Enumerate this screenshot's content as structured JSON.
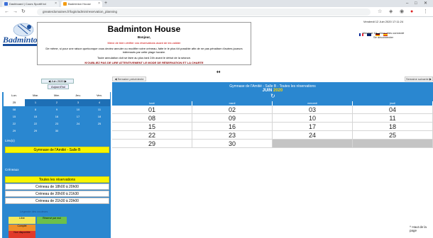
{
  "browser": {
    "tab1_title": "Dashboard | Cours Sportif bd",
    "tab2_title": "Badminton House",
    "url": "greaterdomaines.fr/login/admin/reservation_planning",
    "tabs_close": "×",
    "newtab": "+"
  },
  "header": {
    "title": "Badminton House",
    "greeting": "Bonjour,",
    "red_line": "Merci de bien vérifier vos réservations avant de les valider",
    "line1": "De même, si pour une raison quelconque vous deviez annuler ou modifier votre créneau, faite le le plus tôt possible afin de ne pas pénaliser d'autres joueurs intéressés par cette plage horaire.",
    "line2": "Toute annulation doit se faire au plus tard 24h avant le début de la séance.",
    "red_caps": "N'OUBLIEZ PAS DE LIRE ATTENTIVEMENT LE MODE DE RÉSERVATION ET LA CHARTE",
    "topright_date": "Vendredi 12 Juin 2020 17:11:24",
    "topright_user": "Membre 10 - Vous êtes connecté",
    "topright_logout": "Se déconnecter",
    "arrows": "⬧⬧"
  },
  "flags": [
    "#c8102e",
    "#002868",
    "#ffcc00",
    "#009246"
  ],
  "mini_calendar": {
    "nav": "◀   Juin 2020   ▶",
    "today": "Aujourd'hui",
    "weekdays": [
      "Lun.",
      "Mar.",
      "Mer.",
      "Jeu.",
      "Ven."
    ],
    "weeks": [
      [
        "25",
        "1",
        "2",
        "3",
        "4"
      ],
      [
        "08",
        "8",
        "9",
        "10",
        "11"
      ],
      [
        "15",
        "15",
        "16",
        "17",
        "18"
      ],
      [
        "22",
        "22",
        "23",
        "24",
        "25"
      ],
      [
        "29",
        "29",
        "30",
        "",
        ""
      ]
    ]
  },
  "sidebar": {
    "lieu_label": "Lieu(x)",
    "lieu_value": "Gymnase de l'Amitié - Salle B",
    "creneaux_label": "Créneaux",
    "all_reservations": "Toutes les réservations",
    "slots": [
      "Créneau de 18h00 à 20h00",
      "Créneau de 20h00 à 21h30",
      "Créneau de 21h30 à 23h00"
    ],
    "legend_title": "Légende des couleurs",
    "legend": [
      {
        "text": "Libre",
        "color": "#f5e85a"
      },
      {
        "text": "Réservé par moi",
        "color": "#6cc04a"
      },
      {
        "text": "Complet",
        "color": "#f0902a"
      },
      {
        "text": "Non disponible",
        "color": "#e03a2a"
      }
    ]
  },
  "calendar": {
    "prev_button": "◀ Semaine précédente",
    "next_button": "Semaine suivante ▶",
    "subtitle": "Gymnase de l'Amitié - Salle B - Toutes les réservations",
    "month": "JUIN",
    "year": "2020",
    "refresh": "↻",
    "day_names": [
      "lundi",
      "mardi",
      "mercredi",
      "jeudi"
    ],
    "weeks": [
      [
        "01",
        "02",
        "03",
        "04"
      ],
      [
        "08",
        "09",
        "10",
        "11"
      ],
      [
        "15",
        "16",
        "17",
        "18"
      ],
      [
        "22",
        "23",
        "24",
        "25"
      ],
      [
        "29",
        "30",
        "",
        ""
      ]
    ]
  },
  "back_to_top": "^ Haut de la page"
}
